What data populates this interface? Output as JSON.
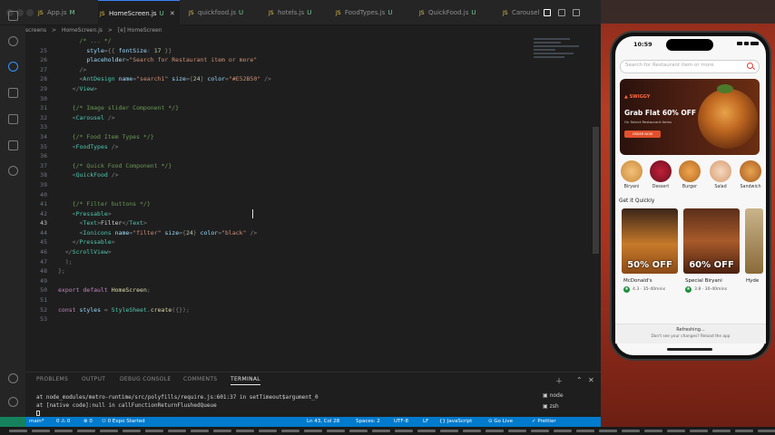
{
  "editor": {
    "tabs": [
      {
        "label": "App.js",
        "mark": "M",
        "active": false
      },
      {
        "label": "HomeScreen.js",
        "mark": "U",
        "active": true
      },
      {
        "label": "quickfood.js",
        "mark": "U",
        "active": false
      },
      {
        "label": "hotels.js",
        "mark": "U",
        "active": false
      },
      {
        "label": "FoodTypes.js",
        "mark": "U",
        "active": false
      },
      {
        "label": "QuickFood.js",
        "mark": "U",
        "active": false
      },
      {
        "label": "Carousel",
        "mark": "",
        "active": false
      }
    ],
    "breadcrumb": [
      "screens",
      ">",
      "HomeScreen.js",
      ">",
      "[e] HomeScreen"
    ],
    "line_numbers": [
      "",
      "25",
      "26",
      "27",
      "28",
      "29",
      "30",
      "31",
      "32",
      "33",
      "34",
      "35",
      "36",
      "37",
      "38",
      "39",
      "40",
      "41",
      "42",
      "43",
      "44",
      "45",
      "46",
      "47",
      "48",
      "49",
      "50",
      "51",
      "52",
      "53"
    ],
    "current_line": "43"
  },
  "terminal": {
    "tabs": [
      "PROBLEMS",
      "OUTPUT",
      "DEBUG CONSOLE",
      "COMMENTS",
      "TERMINAL"
    ],
    "active_tab": "TERMINAL",
    "lines": [
      "at node_modules/metro-runtime/src/polyfills/require.js:601:37 in setTimeout$argument_0",
      "at [native code]:null in callFunctionReturnFlushedQueue"
    ],
    "sessions": [
      "node",
      "zsh"
    ]
  },
  "statusbar": {
    "branch": "main*",
    "errors": "0 ⚠ 0",
    "warn": "⊗ 0",
    "live": "⚇ 0  Expo Started",
    "position": "Ln 43, Col 28",
    "spaces": "Spaces: 2",
    "encoding": "UTF-8",
    "eol": "LF",
    "lang": "{} JavaScript",
    "golive": "⊙ Go Live",
    "prettier": "✓ Prettier"
  },
  "phone": {
    "time": "10:59",
    "search_placeholder": "Search for Restaurant item or more",
    "banner": {
      "brand": "▲ SWIGGY",
      "title": "Grab Flat 60% OFF",
      "subtitle": "On Select Restaurant Items",
      "button": "ORDER NOW"
    },
    "categories": [
      "Biryani",
      "Dessert",
      "Burger",
      "Salad",
      "Sandwich"
    ],
    "quick_title": "Get it Quickly",
    "quick_items": [
      {
        "off": "50% OFF",
        "name": "McDonald's",
        "meta": "4.3 · 35-40mins"
      },
      {
        "off": "60% OFF",
        "name": "Special Biryani",
        "meta": "3.8 · 30-40mins"
      },
      {
        "off": "",
        "name": "Hyde",
        "meta": ""
      }
    ],
    "reload_title": "Refreshing...",
    "reload_sub": "Don't see your changes? Reload the app"
  }
}
